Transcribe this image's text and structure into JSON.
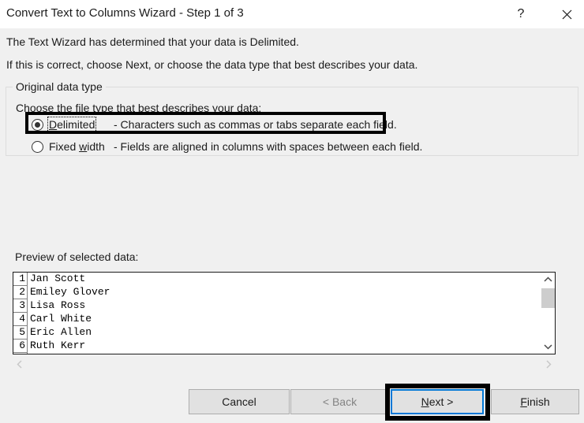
{
  "titlebar": {
    "title": "Convert Text to Columns Wizard - Step 1 of 3",
    "help_label": "?",
    "close_icon": "close-icon"
  },
  "body": {
    "line1": "The Text Wizard has determined that your data is Delimited.",
    "line2": "If this is correct, choose Next, or choose the data type that best describes your data."
  },
  "group": {
    "legend": "Original data type",
    "choose_label": "Choose the file type that best describes your data:",
    "options": [
      {
        "id": "delimited",
        "label_before": "D",
        "label_accel": "D",
        "label": "Delimited",
        "label_head": "D",
        "label_tail": "elimited",
        "description": "- Characters such as commas or tabs separate each field.",
        "selected": "true",
        "focused": "true"
      },
      {
        "id": "fixed-width",
        "label": "Fixed width",
        "label_head": "Fixed ",
        "label_accel": "w",
        "label_tail": "idth",
        "description": "- Fields are aligned in columns with spaces between each field.",
        "selected": "false",
        "focused": "false"
      }
    ]
  },
  "preview": {
    "label": "Preview of selected data:",
    "rows": [
      {
        "num": "1",
        "text": "Jan Scott"
      },
      {
        "num": "2",
        "text": "Emiley Glover"
      },
      {
        "num": "3",
        "text": "Lisa Ross"
      },
      {
        "num": "4",
        "text": "Carl White"
      },
      {
        "num": "5",
        "text": "Eric Allen"
      },
      {
        "num": "6",
        "text": "Ruth Kerr"
      },
      {
        "num": "",
        "text": ""
      }
    ],
    "v_scroll_up_icon": "chevron-up-icon",
    "v_scroll_down_icon": "chevron-down-icon",
    "h_scroll_left_icon": "chevron-left-icon",
    "h_scroll_right_icon": "chevron-right-icon"
  },
  "buttons": {
    "cancel": {
      "label": "Cancel",
      "head": "Cancel",
      "accel": "",
      "tail": "",
      "disabled": "false"
    },
    "back": {
      "label": "< Back",
      "head": "< Back",
      "accel": "",
      "tail": "",
      "disabled": "true"
    },
    "next": {
      "label": "Next >",
      "head": "",
      "accel": "N",
      "tail": "ext >",
      "disabled": "false",
      "default": "true"
    },
    "finish": {
      "label": "Finish",
      "head": "",
      "accel": "F",
      "tail": "inish",
      "disabled": "false"
    }
  },
  "colors": {
    "accent": "#0078d7",
    "dialog_bg": "#f0f0f0",
    "titlebar_bg": "#ffffff",
    "button_bg": "#e1e1e1",
    "highlight_box": "#000000",
    "disabled_text": "#838383"
  }
}
